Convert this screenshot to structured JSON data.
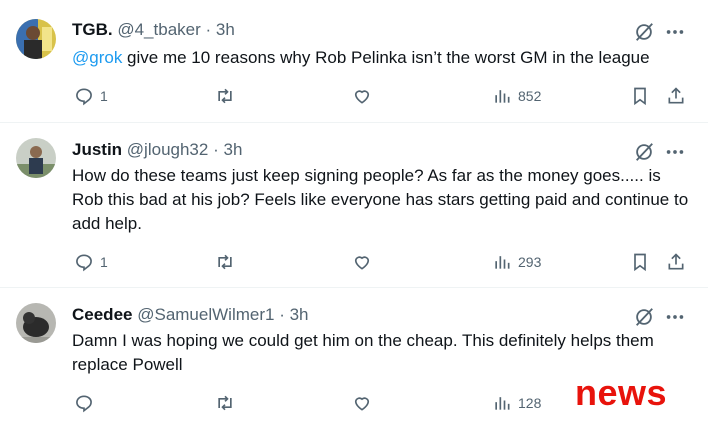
{
  "tweets": [
    {
      "name": "TGB.",
      "handle": "@4_tbaker",
      "separator": "·",
      "time": "3h",
      "mention": "@grok",
      "text": " give me 10 reasons why Rob Pelinka isn’t the worst GM in the league",
      "replies": "1",
      "views": "852"
    },
    {
      "name": "Justin",
      "handle": "@jlough32",
      "separator": "·",
      "time": "3h",
      "text": "How do these teams just keep signing people? As far as the money goes..... is Rob this bad at his job? Feels like everyone has stars getting paid and continue to add help.",
      "replies": "1",
      "views": "293"
    },
    {
      "name": "Ceedee",
      "handle": "@SamuelWilmer1",
      "separator": "·",
      "time": "3h",
      "text": "Damn I was hoping we could get him on the cheap. This definitely helps them replace Powell",
      "replies": "",
      "views": "128"
    }
  ],
  "watermark": "news",
  "colors": {
    "accent": "#1d9bf0",
    "muted": "#536471",
    "watermark": "#e8130c"
  }
}
